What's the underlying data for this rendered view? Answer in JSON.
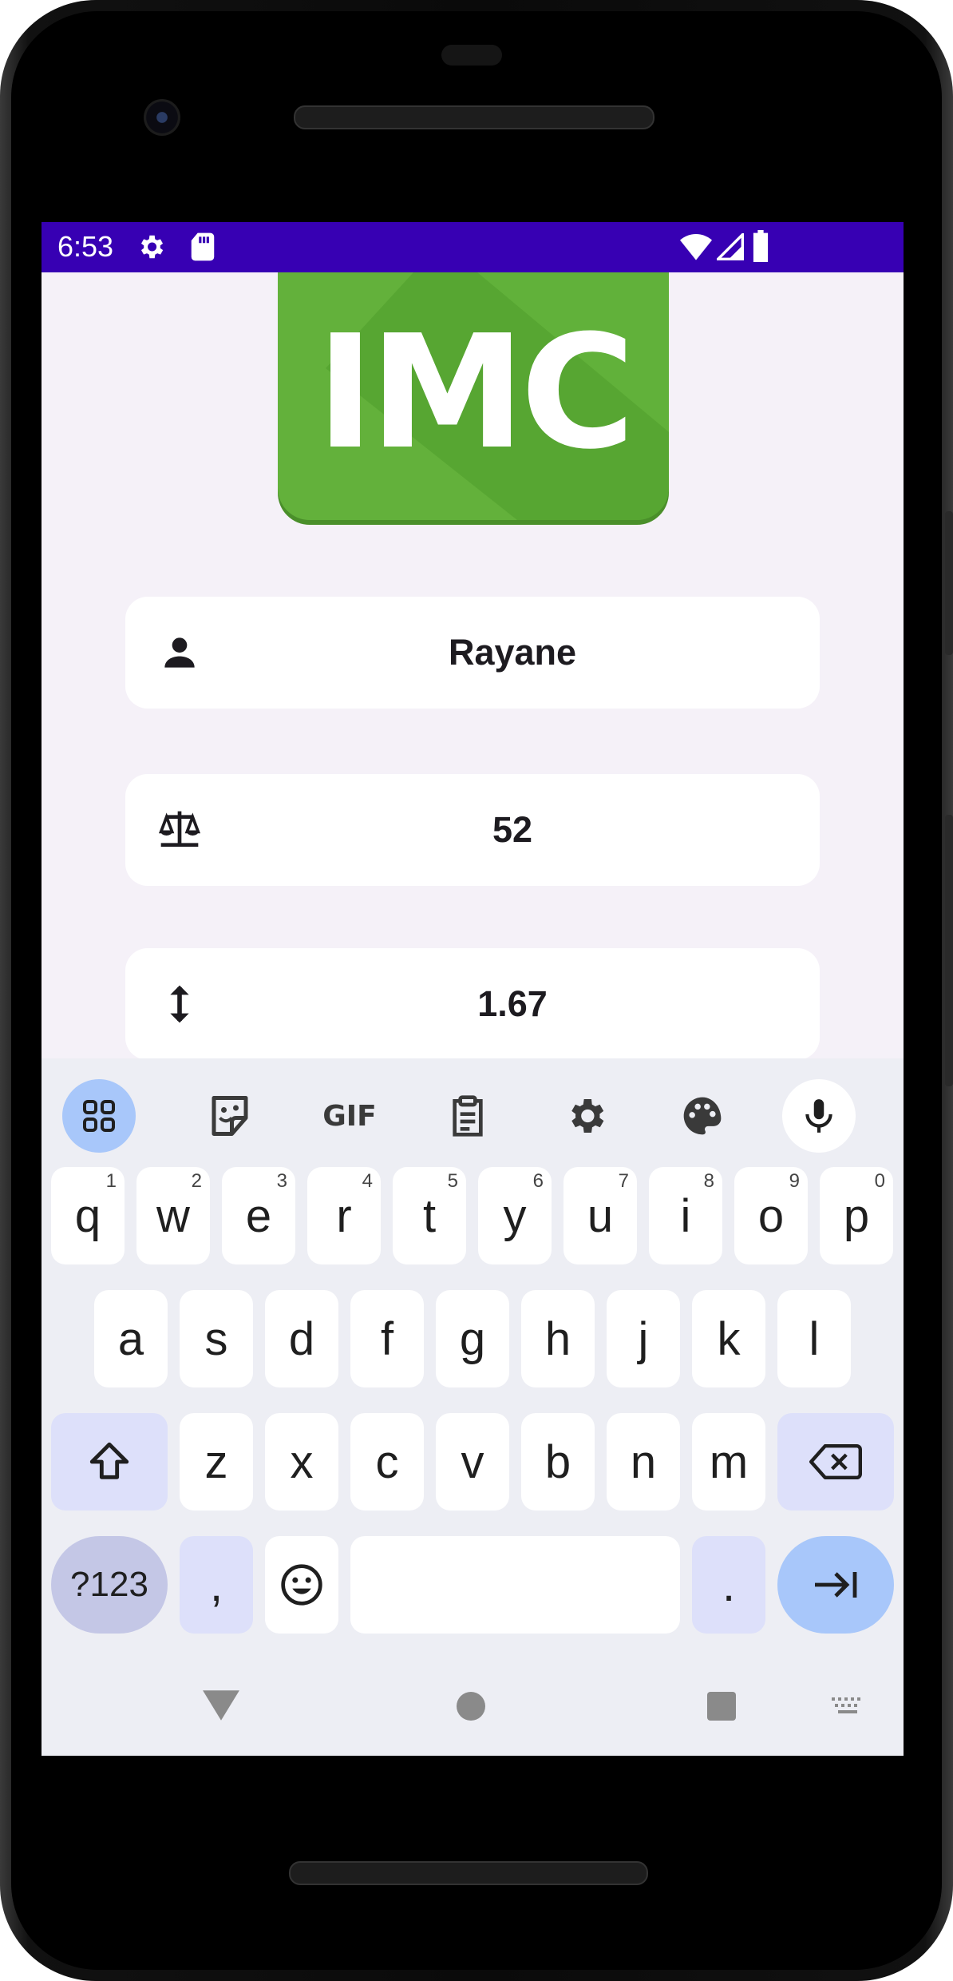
{
  "status_bar": {
    "time": "6:53",
    "icons": [
      "settings-icon",
      "sd-card-icon",
      "wifi-icon",
      "signal-icon",
      "battery-icon"
    ]
  },
  "logo": {
    "text": "IMC",
    "color": "#63b13b"
  },
  "fields": [
    {
      "icon": "person-icon",
      "value": "Rayane"
    },
    {
      "icon": "scale-icon",
      "value": "52"
    },
    {
      "icon": "height-arrows-icon",
      "value": "1.67"
    }
  ],
  "keyboard": {
    "toolbar": [
      "apps-grid-icon",
      "sticker-icon",
      "GIF",
      "clipboard-icon",
      "settings-icon",
      "palette-icon",
      "microphone-icon"
    ],
    "row1": [
      {
        "key": "q",
        "hint": "1"
      },
      {
        "key": "w",
        "hint": "2"
      },
      {
        "key": "e",
        "hint": "3"
      },
      {
        "key": "r",
        "hint": "4"
      },
      {
        "key": "t",
        "hint": "5"
      },
      {
        "key": "y",
        "hint": "6"
      },
      {
        "key": "u",
        "hint": "7"
      },
      {
        "key": "i",
        "hint": "8"
      },
      {
        "key": "o",
        "hint": "9"
      },
      {
        "key": "p",
        "hint": "0"
      }
    ],
    "row2": [
      "a",
      "s",
      "d",
      "f",
      "g",
      "h",
      "j",
      "k",
      "l"
    ],
    "row3": [
      "z",
      "x",
      "c",
      "v",
      "b",
      "n",
      "m"
    ],
    "symbols_key": "?123",
    "comma_key": ",",
    "period_key": ".",
    "space_key": ""
  },
  "colors": {
    "status_bar": "#3700b3",
    "screen_bg": "#f5f1f8",
    "keyboard_bg": "#edeef4",
    "modifier_key": "#dde0fa",
    "action_key": "#a8c7fa"
  }
}
